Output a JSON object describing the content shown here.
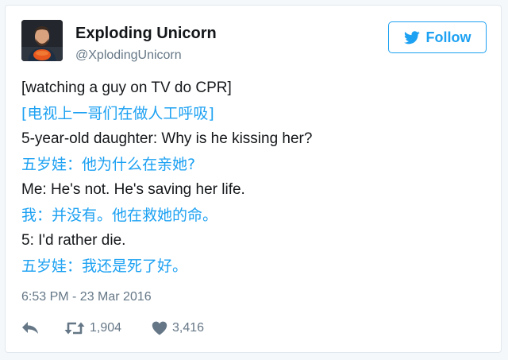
{
  "tweet": {
    "author": {
      "display_name": "Exploding Unicorn",
      "handle": "@XplodingUnicorn"
    },
    "follow_button": {
      "label": "Follow",
      "icon": "bird-icon"
    },
    "lines": [
      {
        "lang": "en",
        "text": "[watching a guy on TV do CPR]"
      },
      {
        "lang": "zh",
        "text": "[电视上一哥们在做人工呼吸]"
      },
      {
        "lang": "en",
        "text": "5-year-old daughter: Why is he kissing her?"
      },
      {
        "lang": "zh",
        "text": "五岁娃：他为什么在亲她?"
      },
      {
        "lang": "en",
        "text": "Me: He's not. He's saving her life."
      },
      {
        "lang": "zh",
        "text": "我：并没有。他在救她的命。"
      },
      {
        "lang": "en",
        "text": "5: I'd rather die."
      },
      {
        "lang": "zh",
        "text": "五岁娃：我还是死了好。"
      }
    ],
    "timestamp": "6:53 PM - 23 Mar 2016",
    "actions": {
      "reply_icon": "reply-icon",
      "retweet_icon": "retweet-icon",
      "retweet_count": "1,904",
      "like_icon": "heart-icon",
      "like_count": "3,416"
    },
    "colors": {
      "accent": "#1da1f2",
      "text": "#14171a",
      "secondary": "#657786",
      "border": "#e1e8ed"
    }
  }
}
